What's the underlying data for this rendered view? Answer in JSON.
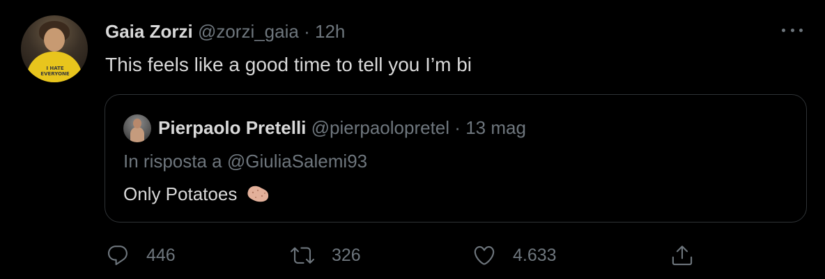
{
  "tweet": {
    "author_name": "Gaia Zorzi",
    "handle": "@zorzi_gaia",
    "separator": "·",
    "time": "12h",
    "text": "This feels like a good time to tell you I’m bi",
    "avatar_shirt_text": "I HATE EVERYONE"
  },
  "quoted_tweet": {
    "author_name": "Pierpaolo Pretelli",
    "handle": "@pierpaolopretel",
    "separator": "·",
    "time": "13 mag",
    "reply_context": "In risposta a @GiuliaSalemi93",
    "text": "Only Potatoes"
  },
  "actions": {
    "replies": "446",
    "retweets": "326",
    "likes": "4.633"
  },
  "colors": {
    "background": "#000000",
    "primary_text": "#d9d9d9",
    "secondary_text": "#6e767d",
    "border": "#2f3336"
  },
  "icons": [
    "more-icon",
    "reply-icon",
    "retweet-icon",
    "like-icon",
    "share-icon",
    "potato-emoji"
  ]
}
